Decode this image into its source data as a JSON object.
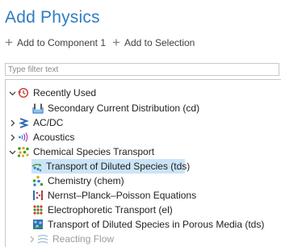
{
  "header": {
    "title": "Add Physics"
  },
  "actions": [
    {
      "label": "Add to Component 1"
    },
    {
      "label": "Add to Selection"
    }
  ],
  "filter": {
    "placeholder": "Type filter text",
    "value": ""
  },
  "tree": {
    "recently_used": "Recently Used",
    "secondary_current": "Secondary Current Distribution (cd)",
    "acdc": "AC/DC",
    "acoustics": "Acoustics",
    "chemical_species_transport": "Chemical Species Transport",
    "transport_diluted": "Transport of Diluted Species (tds)",
    "chemistry": "Chemistry (chem)",
    "nernst_planck": "Nernst–Planck–Poisson Equations",
    "electrophoretic": "Electrophoretic Transport (el)",
    "transport_porous": "Transport of Diluted Species in Porous Media (tds)",
    "reacting_flow": "Reacting Flow"
  },
  "colors": {
    "title": "#2e7dc2",
    "selection": "#cce4f7",
    "accent_green": "#3f9a2e"
  }
}
